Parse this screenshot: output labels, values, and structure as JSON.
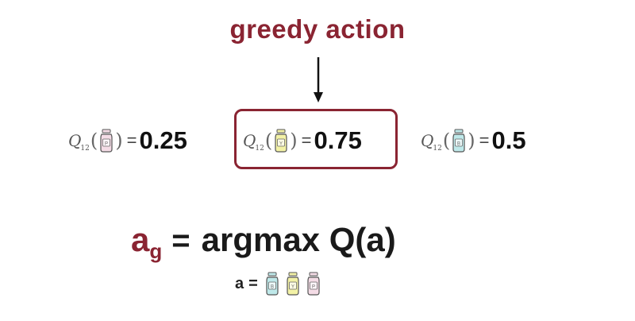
{
  "heading": {
    "text": "greedy action"
  },
  "colors": {
    "accent": "#8a2432",
    "bottle_pink": "#f4dce6",
    "bottle_yellow": "#f3f2a6",
    "bottle_teal": "#bfe9ea"
  },
  "q_values": [
    {
      "symbol": "Q",
      "subscript": "12",
      "bottle": "pink-bottle-icon",
      "bottle_letter": "P",
      "value": "0.25"
    },
    {
      "symbol": "Q",
      "subscript": "12",
      "bottle": "yellow-bottle-icon",
      "bottle_letter": "Y",
      "value": "0.75",
      "highlighted": true
    },
    {
      "symbol": "Q",
      "subscript": "12",
      "bottle": "teal-bottle-icon",
      "bottle_letter": "B",
      "value": "0.5"
    }
  ],
  "formula": {
    "lhs": "a",
    "lhs_sub": "g",
    "equals": "=",
    "rhs": "argmax Q(a)"
  },
  "domain": {
    "label": "a",
    "equals": "=",
    "bottles": [
      "teal-bottle-icon",
      "yellow-bottle-icon",
      "pink-bottle-icon"
    ],
    "bottle_letters": [
      "B",
      "Y",
      "P"
    ]
  }
}
